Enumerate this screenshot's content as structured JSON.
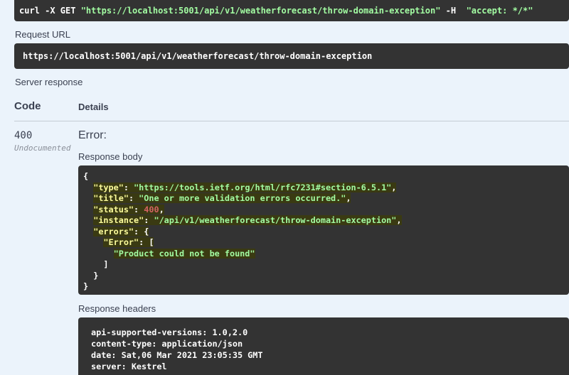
{
  "curl": {
    "prefix": "curl -X GET ",
    "url_quoted": "\"https://localhost:5001/api/v1/weatherforecast/throw-domain-exception\"",
    "flag": " -H  ",
    "header_quoted": "\"accept: */*\""
  },
  "request_url": {
    "label": "Request URL",
    "value": "https://localhost:5001/api/v1/weatherforecast/throw-domain-exception"
  },
  "server_response": {
    "label": "Server response",
    "columns": {
      "code": "Code",
      "details": "Details"
    },
    "status_code": "400",
    "status_note": "Undocumented",
    "error_title": "Error:",
    "body_label": "Response body",
    "body": {
      "open": "{",
      "type_key": "\"type\"",
      "type_val": "\"https://tools.ietf.org/html/rfc7231#section-6.5.1\"",
      "title_key": "\"title\"",
      "title_val": "\"One or more validation errors occurred.\"",
      "status_key": "\"status\"",
      "status_val": "400",
      "instance_key": "\"instance\"",
      "instance_val": "\"/api/v1/weatherforecast/throw-domain-exception\"",
      "errors_key": "\"errors\"",
      "error_key": "\"Error\"",
      "error_msg": "\"Product could not be found\"",
      "close": "}"
    },
    "headers_label": "Response headers",
    "headers": [
      "api-supported-versions: 1.0,2.0",
      "content-type: application/json",
      "date: Sat,06 Mar 2021 23:05:35 GMT",
      "server: Kestrel"
    ]
  },
  "colors": {
    "page_bg": "#ebf3fb",
    "code_bg": "#333333",
    "string_green": "#a2fca2",
    "key_yellow": "#fcfc9c",
    "number_red": "#d36363",
    "highlight": "#3a3a12"
  }
}
